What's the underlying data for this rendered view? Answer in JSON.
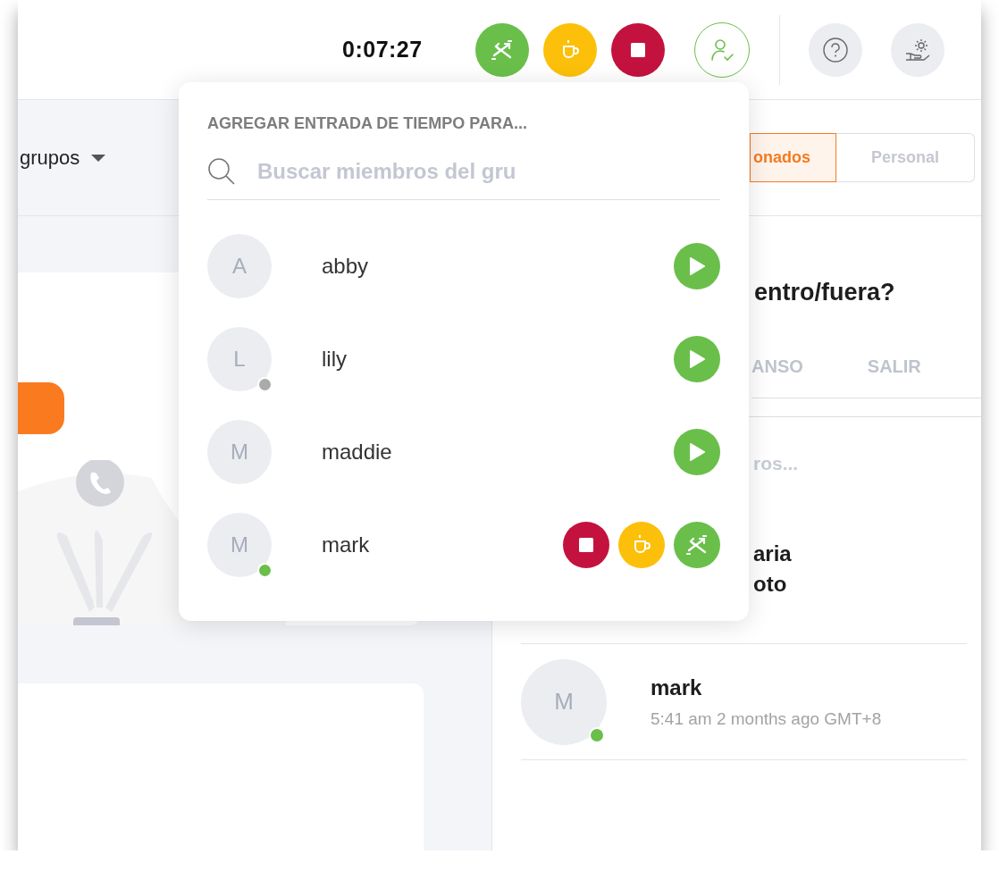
{
  "timer": "0:07:27",
  "quick_actions": [
    {
      "kind": "switch"
    },
    {
      "kind": "break"
    },
    {
      "kind": "stop"
    }
  ],
  "left": {
    "group_filter": "grupos"
  },
  "right": {
    "segments": [
      {
        "label": "onados",
        "selected": true
      },
      {
        "label": "Personal",
        "selected": false
      }
    ],
    "question": "entro/fuera?",
    "tabs": [
      {
        "label": "ANSO"
      },
      {
        "label": "SALIR"
      }
    ],
    "search": {
      "placeholder": "ros..."
    },
    "members": [
      {
        "name_lines": [
          "aria",
          "oto"
        ]
      },
      {
        "initial": "M",
        "name_lines": [
          "mark"
        ],
        "time": "5:41 am 2 months ago GMT+8",
        "color": "#6abf4b"
      }
    ]
  },
  "popup": {
    "title": "AGREGAR ENTRADA DE TIEMPO PARA...",
    "search": {
      "placeholder": "Buscar miembros del gru"
    },
    "members": [
      {
        "initial": "A",
        "name": "abby",
        "actions": [
          {
            "kind": "start"
          }
        ]
      },
      {
        "initial": "L",
        "name": "lily",
        "color": "#aaaaaa",
        "actions": [
          {
            "kind": "start"
          }
        ]
      },
      {
        "initial": "M",
        "name": "maddie",
        "actions": [
          {
            "kind": "start"
          }
        ]
      },
      {
        "initial": "M",
        "name": "mark",
        "color": "#6abf4b",
        "actions": [
          {
            "kind": "stop"
          },
          {
            "kind": "break"
          },
          {
            "kind": "switch"
          }
        ]
      }
    ]
  }
}
